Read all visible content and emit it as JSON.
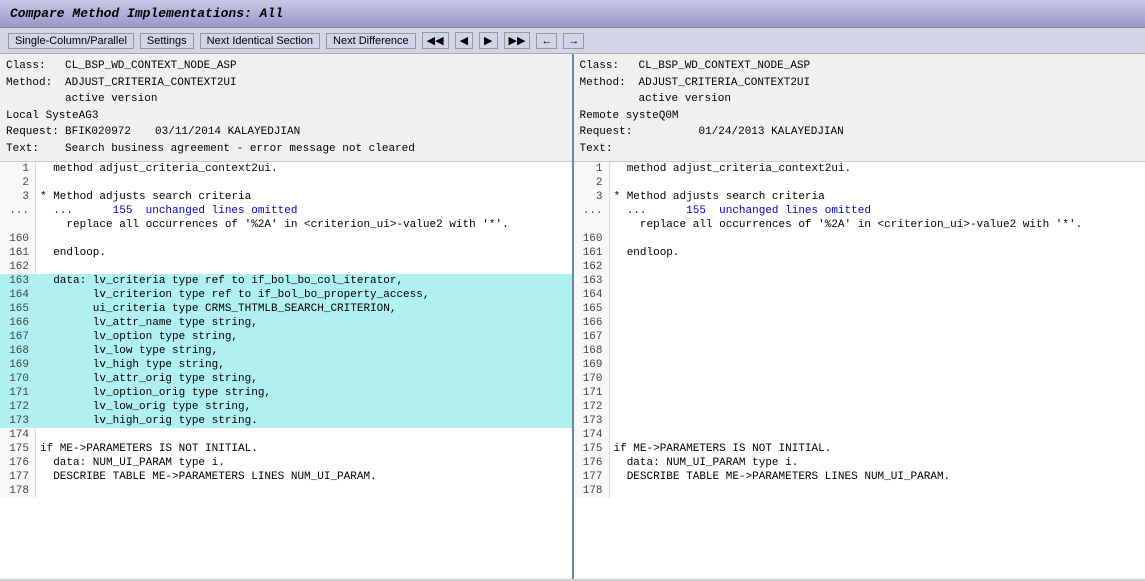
{
  "title": "Compare Method Implementations: All",
  "toolbar": {
    "single_column_label": "Single-Column/Parallel",
    "settings_label": "Settings",
    "next_identical_label": "Next Identical Section",
    "next_difference_label": "Next Difference"
  },
  "left_pane": {
    "class_label": "Class:",
    "class_value": "CL_BSP_WD_CONTEXT_NODE_ASP",
    "method_label": "Method:",
    "method_value": "ADJUST_CRITERIA_CONTEXT2UI",
    "version": "active version",
    "system_label": "Local SysteAG3",
    "request_label": "Request:",
    "request_value": "BFIK020972",
    "request_date": "03/11/2014 KALAYEDJIAN",
    "text_label": "Text:",
    "text_value": "Search business agreement - error message not cleared"
  },
  "right_pane": {
    "class_label": "Class:",
    "class_value": "CL_BSP_WD_CONTEXT_NODE_ASP",
    "method_label": "Method:",
    "method_value": "ADJUST_CRITERIA_CONTEXT2UI",
    "version": "active version",
    "system_label": "Remote systeQ0M",
    "request_label": "Request:",
    "request_date": "01/24/2013 KALAYEDJIAN",
    "text_label": "Text:"
  },
  "left_code": [
    {
      "num": "1",
      "content": "  method adjust_criteria_context2ui.",
      "highlight": false
    },
    {
      "num": "2",
      "content": "",
      "highlight": false
    },
    {
      "num": "3",
      "content": "* Method adjusts search criteria",
      "highlight": false
    },
    {
      "num": "...",
      "content": "  ...      155  unchanged lines omitted",
      "highlight": false,
      "omitted": true
    },
    {
      "num": "",
      "content": "    replace all occurrences of '%2A' in <criterion_ui>-value2 with '*'.",
      "highlight": false
    },
    {
      "num": "160",
      "content": "",
      "highlight": false
    },
    {
      "num": "161",
      "content": "  endloop.",
      "highlight": false
    },
    {
      "num": "162",
      "content": "",
      "highlight": false
    },
    {
      "num": "163",
      "content": "  data: lv_criteria type ref to if_bol_bo_col_iterator,",
      "highlight": true
    },
    {
      "num": "164",
      "content": "        lv_criterion type ref to if_bol_bo_property_access,",
      "highlight": true
    },
    {
      "num": "165",
      "content": "        ui_criteria type CRMS_THTMLB_SEARCH_CRITERION,",
      "highlight": true
    },
    {
      "num": "166",
      "content": "        lv_attr_name type string,",
      "highlight": true
    },
    {
      "num": "167",
      "content": "        lv_option type string,",
      "highlight": true
    },
    {
      "num": "168",
      "content": "        lv_low type string,",
      "highlight": true
    },
    {
      "num": "169",
      "content": "        lv_high type string,",
      "highlight": true
    },
    {
      "num": "170",
      "content": "        lv_attr_orig type string,",
      "highlight": true
    },
    {
      "num": "171",
      "content": "        lv_option_orig type string,",
      "highlight": true
    },
    {
      "num": "172",
      "content": "        lv_low_orig type string,",
      "highlight": true
    },
    {
      "num": "173",
      "content": "        lv_high_orig type string.",
      "highlight": true
    },
    {
      "num": "174",
      "content": "",
      "highlight": false
    },
    {
      "num": "175",
      "content": "if ME->PARAMETERS IS NOT INITIAL.",
      "highlight": false
    },
    {
      "num": "176",
      "content": "  data: NUM_UI_PARAM type i.",
      "highlight": false
    },
    {
      "num": "177",
      "content": "  DESCRIBE TABLE ME->PARAMETERS LINES NUM_UI_PARAM.",
      "highlight": false
    },
    {
      "num": "178",
      "content": "",
      "highlight": false
    }
  ],
  "right_code": [
    {
      "num": "1",
      "content": "  method adjust_criteria_context2ui.",
      "highlight": false
    },
    {
      "num": "2",
      "content": "",
      "highlight": false
    },
    {
      "num": "3",
      "content": "* Method adjusts search criteria",
      "highlight": false
    },
    {
      "num": "...",
      "content": "  ...      155  unchanged lines omitted",
      "highlight": false,
      "omitted": true
    },
    {
      "num": "",
      "content": "    replace all occurrences of '%2A' in <criterion_ui>-value2 with '*'.",
      "highlight": false
    },
    {
      "num": "160",
      "content": "",
      "highlight": false
    },
    {
      "num": "161",
      "content": "  endloop.",
      "highlight": false
    },
    {
      "num": "162",
      "content": "",
      "highlight": false
    },
    {
      "num": "163",
      "content": "",
      "highlight": false
    },
    {
      "num": "164",
      "content": "",
      "highlight": false
    },
    {
      "num": "165",
      "content": "",
      "highlight": false
    },
    {
      "num": "166",
      "content": "",
      "highlight": false
    },
    {
      "num": "167",
      "content": "",
      "highlight": false
    },
    {
      "num": "168",
      "content": "",
      "highlight": false
    },
    {
      "num": "169",
      "content": "",
      "highlight": false
    },
    {
      "num": "170",
      "content": "",
      "highlight": false
    },
    {
      "num": "171",
      "content": "",
      "highlight": false
    },
    {
      "num": "172",
      "content": "",
      "highlight": false
    },
    {
      "num": "173",
      "content": "",
      "highlight": false
    },
    {
      "num": "174",
      "content": "",
      "highlight": false
    },
    {
      "num": "175",
      "content": "if ME->PARAMETERS IS NOT INITIAL.",
      "highlight": false
    },
    {
      "num": "176",
      "content": "  data: NUM_UI_PARAM type i.",
      "highlight": false
    },
    {
      "num": "177",
      "content": "  DESCRIBE TABLE ME->PARAMETERS LINES NUM_UI_PARAM.",
      "highlight": false
    },
    {
      "num": "178",
      "content": "",
      "highlight": false
    }
  ]
}
